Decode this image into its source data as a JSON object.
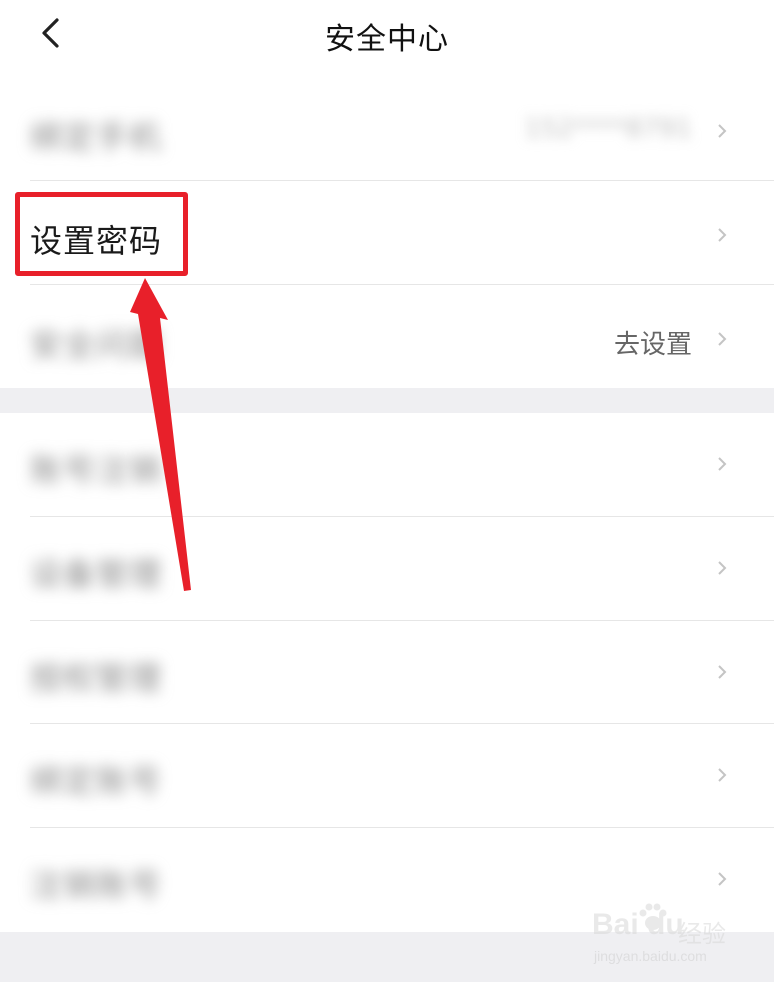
{
  "header": {
    "title": "安全中心",
    "back_icon": "chevron-left-icon"
  },
  "section1": {
    "rows": [
      {
        "label": "绑定手机",
        "value": "152****8791"
      },
      {
        "label": "设置密码",
        "value": ""
      },
      {
        "label": "安全问题",
        "value": "去设置"
      }
    ]
  },
  "section2": {
    "rows": [
      {
        "label": "账号注销"
      },
      {
        "label": "设备管理"
      },
      {
        "label": "授权管理"
      },
      {
        "label": "绑定账号"
      },
      {
        "label": "注销账号"
      }
    ]
  },
  "annotation": {
    "highlight_color": "#e8202a"
  },
  "watermark": {
    "logo": "Bai du",
    "cn": "经验",
    "url": "jingyan.baidu.com"
  },
  "colors": {
    "separator_gray": "#efeff2",
    "divider": "#e6e6e6",
    "accent_red": "#e8202a"
  }
}
